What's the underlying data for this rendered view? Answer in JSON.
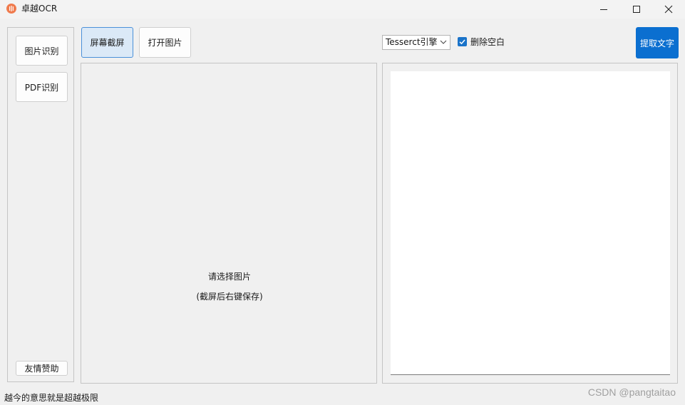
{
  "window": {
    "title": "卓越OCR",
    "accent_color": "#f07b4e"
  },
  "sidebar": {
    "image_ocr_label": "图片识别",
    "pdf_ocr_label": "PDF识别",
    "donate_label": "友情赞助"
  },
  "toolbar": {
    "screenshot_label": "屏幕截屏",
    "open_image_label": "打开图片",
    "engine_selected": "Tesserct引擎",
    "remove_whitespace_label": "删除空白",
    "remove_whitespace_checked": true,
    "extract_label": "提取文字",
    "extract_color": "#0b6fd0"
  },
  "image_panel": {
    "hint_line1": "请选择图片",
    "hint_line2": "(截屏后右键保存)"
  },
  "result_panel": {
    "text": ""
  },
  "status": {
    "text": "越今的意思就是超越极限"
  },
  "watermark": {
    "text": "CSDN @pangtaitao"
  }
}
